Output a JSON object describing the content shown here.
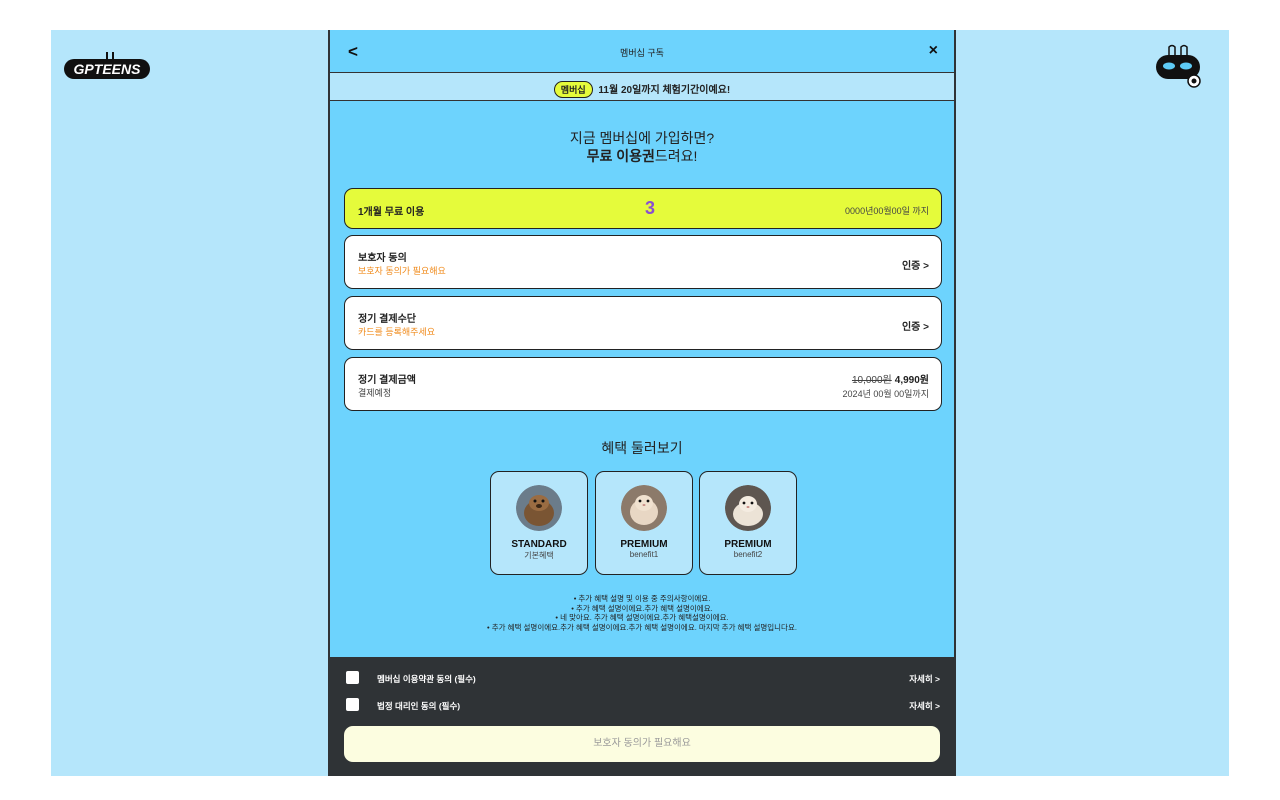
{
  "app": {
    "logo_text": "GPTEENS"
  },
  "topbar": {
    "back_glyph": "<",
    "title": "멤버십 구독",
    "close_glyph": "×"
  },
  "notice": {
    "badge": "멤버십",
    "text": "11월 20일까지 체험기간이예요!"
  },
  "headline": {
    "line1": "지금 멤버십에 가입하면?",
    "line2_bold": "무료 이용권",
    "line2_rest": "드려요!"
  },
  "free_card": {
    "label": "1개월 무료 이용",
    "count": "3",
    "date": "0000년00월00일 까지"
  },
  "guardian_card": {
    "label": "보호자 동의",
    "sub": "보호자 동의가 필요해요",
    "action": "인증 >"
  },
  "payment_method_card": {
    "label": "정기 결제수단",
    "sub": "카드를 등록해주세요",
    "action": "인증 >"
  },
  "amount_card": {
    "label": "정기 결제금액",
    "sub": "결제예정",
    "original_price": "10,000원",
    "price": "4,990원",
    "date": "2024년 00월 00일까지"
  },
  "benefits": {
    "title": "혜택 둘러보기",
    "items": [
      {
        "name": "STANDARD",
        "desc": "기본혜택",
        "avatar_icon": "otter-photo"
      },
      {
        "name": "PREMIUM",
        "desc": "benefit1",
        "avatar_icon": "hamster-photo"
      },
      {
        "name": "PREMIUM",
        "desc": "benefit2",
        "avatar_icon": "hamster-photo"
      }
    ]
  },
  "bullets": [
    "• 추가 혜택 설명 및 이용 중 주의사항이에요.",
    "• 추가 혜택 설명이에요.추가 혜택 설명이에요.",
    "• 네 맞아요. 추가 혜택 설명이에요.추가 혜택설명이에요.",
    "• 추가 혜택 설명이에요.추가 혜택 설명이에요.추가 혜택 설명이에요. 마지막 추가 혜택 설명입니다요."
  ],
  "agreements": [
    {
      "label": "멤버십 이용약관 동의 (필수)",
      "more": "자세히 >",
      "checked": false
    },
    {
      "label": "법정 대리인 동의 (필수)",
      "more": "자세히 >",
      "checked": false
    }
  ],
  "cta": {
    "label": "보호자 동의가 필요해요"
  },
  "colors": {
    "panel_blue": "#6dd3fd",
    "light_blue": "#b5e6fb",
    "accent_yellow": "#e5fb3b",
    "warning_orange": "#f08b1d",
    "footer_dark": "#2f3336",
    "count_purple": "#8a4fd0"
  }
}
